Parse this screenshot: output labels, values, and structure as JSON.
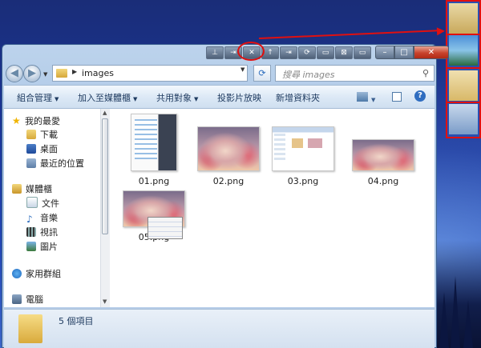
{
  "window": {
    "address_path": "images",
    "search_placeholder": "搜尋 images",
    "caption_tools": [
      "⊥",
      "⇥",
      "✕",
      "↑",
      "⇥",
      "⟳",
      "▭",
      "⊠",
      "▭"
    ],
    "minimize": "–",
    "maximize": "□",
    "close": "✕"
  },
  "commands": {
    "organize": "組合管理",
    "add_to_library": "加入至媒體櫃",
    "share": "共用對象",
    "slideshow": "投影片放映",
    "new_folder": "新增資料夾"
  },
  "nav": {
    "favorites": "我的最愛",
    "downloads": "下載",
    "desktop": "桌面",
    "recent": "最近的位置",
    "libraries": "媒體櫃",
    "documents": "文件",
    "music": "音樂",
    "videos": "視訊",
    "pictures": "圖片",
    "homegroup": "家用群組",
    "computer": "電腦"
  },
  "files": [
    "01.png",
    "02.png",
    "03.png",
    "04.png",
    "05.png"
  ],
  "status": {
    "item_count": "5 個項目"
  },
  "colors": {
    "annotation_red": "#e01010",
    "window_chrome": "#a9c4e4",
    "close_red": "#c8432c"
  }
}
